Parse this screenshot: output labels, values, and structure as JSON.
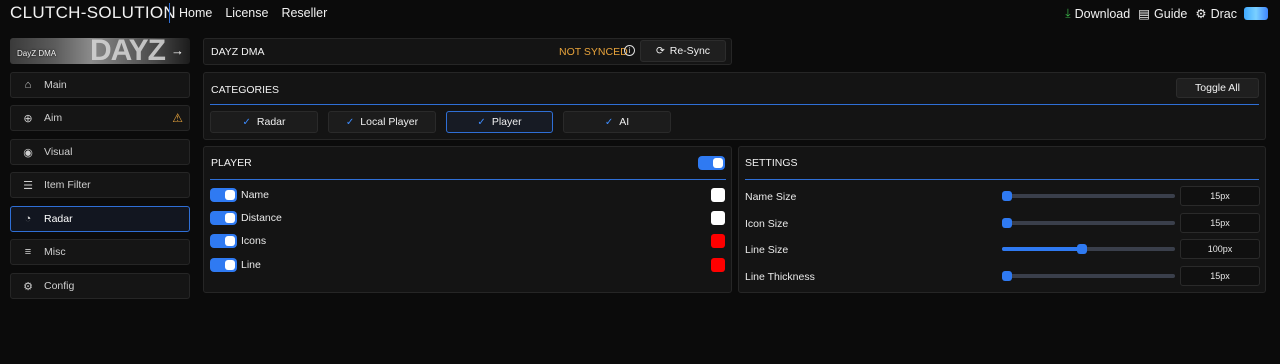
{
  "app": {
    "brand": "CLUTCH-SOLUTION"
  },
  "nav": {
    "items": [
      "Home",
      "License",
      "Reseller"
    ]
  },
  "right_nav": {
    "download": "Download",
    "guide": "Guide",
    "user": "Drac"
  },
  "sidebar": {
    "banner": {
      "game_label": "DayZ DMA",
      "art_text": "DAYZ"
    },
    "items": [
      {
        "label": "Main",
        "icon": "home-icon"
      },
      {
        "label": "Aim",
        "icon": "crosshair-icon",
        "warning": true
      },
      {
        "label": "Visual",
        "icon": "eye-icon"
      },
      {
        "label": "Item Filter",
        "icon": "list-icon"
      },
      {
        "label": "Radar",
        "icon": "radar-icon",
        "active": true
      },
      {
        "label": "Misc",
        "icon": "menu-icon"
      },
      {
        "label": "Config",
        "icon": "gears-icon"
      }
    ]
  },
  "product": {
    "title": "DAYZ DMA",
    "sync_status": "NOT SYNCED",
    "resync_label": "Re-Sync"
  },
  "categories": {
    "title": "CATEGORIES",
    "toggle_all_label": "Toggle All",
    "items": [
      {
        "label": "Radar",
        "checked": true
      },
      {
        "label": "Local Player",
        "checked": true
      },
      {
        "label": "Player",
        "checked": true,
        "active": true
      },
      {
        "label": "AI",
        "checked": true
      }
    ]
  },
  "player": {
    "title": "PLAYER",
    "master_enabled": true,
    "options": [
      {
        "label": "Name",
        "enabled": true,
        "color": "#ffffff"
      },
      {
        "label": "Distance",
        "enabled": true,
        "color": "#ffffff"
      },
      {
        "label": "Icons",
        "enabled": true,
        "color": "#ff0000"
      },
      {
        "label": "Line",
        "enabled": true,
        "color": "#ff0000"
      }
    ]
  },
  "settings": {
    "title": "SETTINGS",
    "sliders": [
      {
        "label": "Name Size",
        "value": "15px",
        "fraction": 0.03
      },
      {
        "label": "Icon Size",
        "value": "15px",
        "fraction": 0.03
      },
      {
        "label": "Line Size",
        "value": "100px",
        "fraction": 0.46
      },
      {
        "label": "Line Thickness",
        "value": "15px",
        "fraction": 0.03
      }
    ]
  },
  "colors": {
    "accent": "#2f7af2",
    "warning": "#e8a33b",
    "download": "#3bb54a"
  }
}
